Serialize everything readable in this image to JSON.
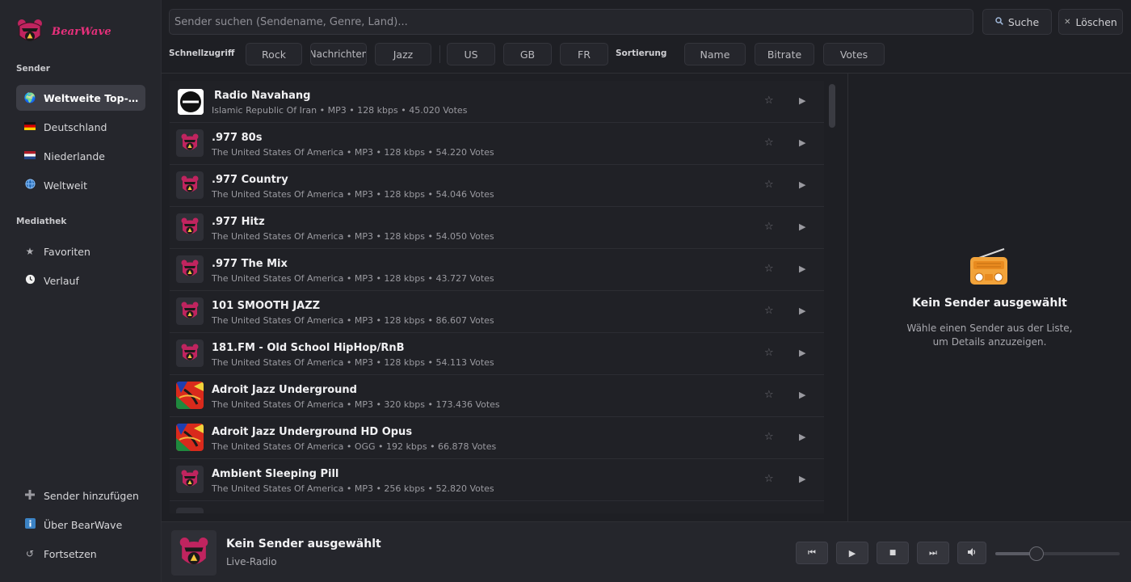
{
  "app": {
    "logo_text": "BearWave"
  },
  "sidebar": {
    "sections": [
      {
        "title": "Sender",
        "items": [
          {
            "label": "Weltweite Top-Sender",
            "icon": "globe-americas-icon",
            "glyph": "🌍",
            "active": true
          },
          {
            "label": "Deutschland",
            "icon": "germany-flag-icon",
            "glyph": "🇩🇪"
          },
          {
            "label": "Niederlande",
            "icon": "netherlands-flag-icon",
            "glyph": "🇳🇱"
          },
          {
            "label": "Weltweit",
            "icon": "globe-meridians-icon",
            "glyph": "🌐"
          }
        ]
      },
      {
        "title": "Mediathek",
        "items": [
          {
            "label": "Favoriten",
            "icon": "star-icon",
            "glyph": "★"
          },
          {
            "label": "Verlauf",
            "icon": "clock-icon",
            "glyph": "🕒"
          }
        ]
      }
    ],
    "footer": [
      {
        "label": "Sender hinzufügen",
        "icon": "plus-icon",
        "glyph": "➕"
      },
      {
        "label": "Über BearWave",
        "icon": "info-icon",
        "glyph": "ℹ️"
      },
      {
        "label": "Fortsetzen",
        "icon": "refresh-icon",
        "glyph": "↺"
      }
    ]
  },
  "search": {
    "placeholder": "Sender suchen (Sendename, Genre, Land)...",
    "value": "",
    "search_label": "Suche",
    "search_icon": "magnifier-icon",
    "clear_label": "Löschen",
    "clear_icon": "close-icon"
  },
  "quick_access": {
    "label": "Schnellzugriff",
    "genres": [
      "Rock",
      "Nachrichten",
      "Jazz"
    ],
    "countries": [
      "US",
      "GB",
      "FR"
    ]
  },
  "sorting": {
    "label": "Sortierung",
    "options": [
      "Name",
      "Bitrate",
      "Votes"
    ]
  },
  "stations": [
    {
      "name": "Radio Navahang",
      "meta": "Islamic Republic Of Iran  •  MP3  •  128 kbps  •  45.020 Votes",
      "thumb": "navahang"
    },
    {
      "name": ".977 80s",
      "meta": "The United States Of America  •  MP3  •  128 kbps  •  54.220 Votes",
      "thumb": "bear"
    },
    {
      "name": ".977 Country",
      "meta": "The United States Of America  •  MP3  •  128 kbps  •  54.046 Votes",
      "thumb": "bear"
    },
    {
      "name": ".977 Hitz",
      "meta": "The United States Of America  •  MP3  •  128 kbps  •  54.050 Votes",
      "thumb": "bear"
    },
    {
      "name": ".977 The Mix",
      "meta": "The United States Of America  •  MP3  •  128 kbps  •  43.727 Votes",
      "thumb": "bear"
    },
    {
      "name": "101 SMOOTH JAZZ",
      "meta": "The United States Of America  •  MP3  •  128 kbps  •  86.607 Votes",
      "thumb": "bear"
    },
    {
      "name": "181.FM - Old School HipHop/RnB",
      "meta": "The United States Of America  •  MP3  •  128 kbps  •  54.113 Votes",
      "thumb": "bear"
    },
    {
      "name": "Adroit Jazz Underground",
      "meta": "The United States Of America  •  MP3  •  320 kbps  •  173.436 Votes",
      "thumb": "art"
    },
    {
      "name": "Adroit Jazz Underground HD Opus",
      "meta": "The United States Of America  •  OGG  •  192 kbps  •  66.878 Votes",
      "thumb": "art"
    },
    {
      "name": "Ambient Sleeping Pill",
      "meta": "The United States Of America  •  MP3  •  256 kbps  •  52.820 Votes",
      "thumb": "bear"
    }
  ],
  "row_icons": {
    "favorite": "star-outline-icon",
    "play": "play-icon"
  },
  "detail": {
    "icon": "radio-icon",
    "title": "Kein Sender ausgewählt",
    "subtitle_line1": "Wähle einen Sender aus der Liste,",
    "subtitle_line2": "um Details anzuzeigen."
  },
  "player": {
    "title": "Kein Sender ausgewählt",
    "subtitle": "Live-Radio",
    "buttons": [
      {
        "icon": "previous-icon",
        "glyph": "⏮"
      },
      {
        "icon": "play-icon",
        "glyph": "▶"
      },
      {
        "icon": "stop-icon",
        "glyph": "■"
      },
      {
        "icon": "next-icon",
        "glyph": "⏭"
      },
      {
        "icon": "speaker-icon",
        "glyph": "🔊"
      }
    ],
    "volume": 0.33
  },
  "colors": {
    "accent": "#e8307c",
    "background": "#1e1f24",
    "sidebar": "#25262c",
    "radio_body": "#f2a33a"
  }
}
